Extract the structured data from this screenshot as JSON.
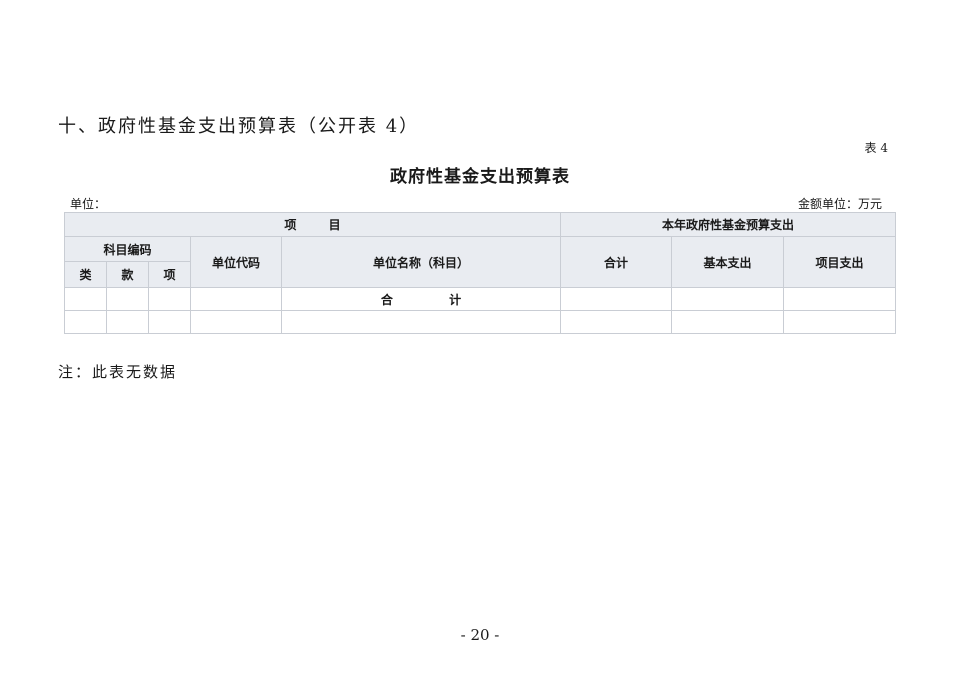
{
  "heading": "十、政府性基金支出预算表（公开表 4）",
  "table_no": "表 4",
  "title": "政府性基金支出预算表",
  "unit_left": "单位：",
  "unit_right": "金额单位：万元",
  "table": {
    "group_item": "项 目",
    "group_budget": "本年政府性基金预算支出",
    "subject_code": "科目编码",
    "class": "类",
    "section": "款",
    "item": "项",
    "unit_code": "单位代码",
    "unit_name": "单位名称（科目）",
    "total": "合计",
    "basic": "基本支出",
    "project": "项目支出",
    "total_row_label": "合 计"
  },
  "note": "注：此表无数据",
  "page_number": "- 20 -"
}
